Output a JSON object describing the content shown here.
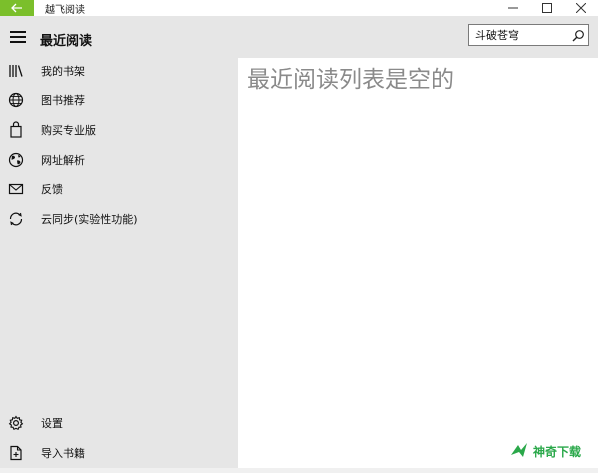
{
  "window": {
    "title": "越飞阅读",
    "controls": [
      "minimize-icon",
      "maximize-icon",
      "close-icon"
    ]
  },
  "header": {
    "title": "最近阅读",
    "search": {
      "value": "斗破苍穹",
      "icon": "search-icon"
    }
  },
  "sidebar": {
    "items": [
      {
        "label": "我的书架",
        "icon": "bookshelf-icon"
      },
      {
        "label": "图书推荐",
        "icon": "globe-icon"
      },
      {
        "label": "购买专业版",
        "icon": "shopping-bag-icon"
      },
      {
        "label": "网址解析",
        "icon": "earth-icon"
      },
      {
        "label": "反馈",
        "icon": "mail-icon"
      },
      {
        "label": "云同步(实验性功能)",
        "icon": "sync-icon"
      }
    ],
    "bottom_items": [
      {
        "label": "设置",
        "icon": "gear-icon"
      },
      {
        "label": "导入书籍",
        "icon": "import-file-icon"
      }
    ]
  },
  "main": {
    "empty_message": "最近阅读列表是空的"
  },
  "watermark": {
    "text": "神奇下载"
  },
  "colors": {
    "accent": "#7bbf2b",
    "sidebar_bg": "#e6e6e6",
    "content_bg": "#ffffff",
    "empty_text": "#8a8a8a",
    "watermark": "#2aa84a"
  }
}
